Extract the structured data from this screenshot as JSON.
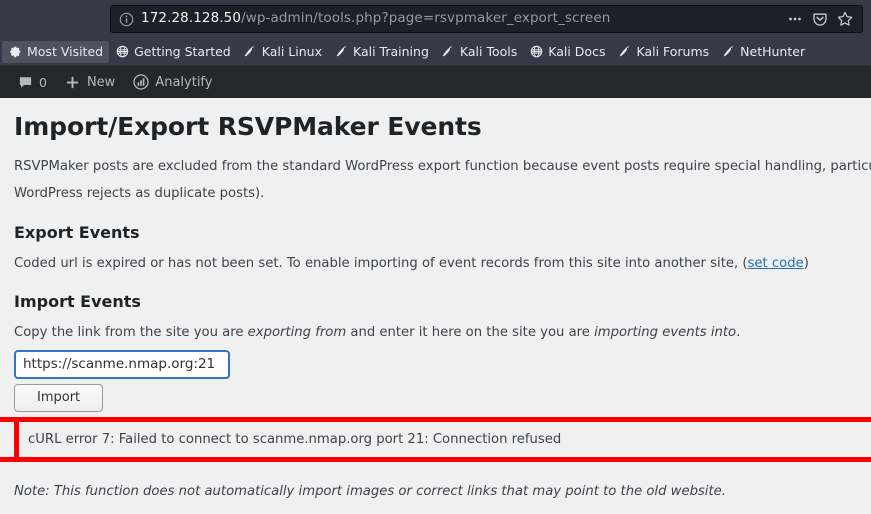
{
  "browser": {
    "url_host": "172.28.128.50",
    "url_path": "/wp-admin/tools.php?page=rsvpmaker_export_screen",
    "identity_icon": "info-icon",
    "page_actions_label": "…",
    "save_to_pocket_label": "save-to-pocket-icon",
    "bookmark_star_label": "bookmark-star-icon",
    "bookmarks": [
      {
        "label": "Most Visited",
        "icon": "gear-icon",
        "active": true
      },
      {
        "label": "Getting Started",
        "icon": "globe-icon",
        "active": false
      },
      {
        "label": "Kali Linux",
        "icon": "dragon-icon",
        "active": false
      },
      {
        "label": "Kali Training",
        "icon": "dragon-icon",
        "active": false
      },
      {
        "label": "Kali Tools",
        "icon": "dragon-icon",
        "active": false
      },
      {
        "label": "Kali Docs",
        "icon": "globe-icon",
        "active": false
      },
      {
        "label": "Kali Forums",
        "icon": "dragon-icon",
        "active": false
      },
      {
        "label": "NetHunter",
        "icon": "dragon-icon",
        "active": false
      }
    ]
  },
  "adminbar": {
    "comments_count": "0",
    "comments_icon": "comment-bubble-icon",
    "new_label": "New",
    "new_icon": "plus-icon",
    "analytify_label": "Analytify",
    "analytify_icon": "bar-chart-circle-icon"
  },
  "page": {
    "title": "Import/Export RSVPMaker Events",
    "intro_line1": "RSVPMaker posts are excluded from the standard WordPress export function because event posts require special handling, particularly those that hav",
    "intro_line2": "WordPress rejects as duplicate posts).",
    "export": {
      "heading": "Export Events",
      "text_before_link": "Coded url is expired or has not been set. To enable importing of event records from this site into another site, (",
      "link_label": "set code",
      "text_after_link": ")"
    },
    "import": {
      "heading": "Import Events",
      "instruction_part1": "Copy the link from the site you are ",
      "instruction_em1": "exporting from",
      "instruction_part2": " and enter it here on the site you are ",
      "instruction_em2": "importing events into",
      "instruction_part3": ".",
      "input_value": "https://scanme.nmap.org:21",
      "input_placeholder": "",
      "button_label": "Import",
      "error_message": "cURL error 7: Failed to connect to scanme.nmap.org port 21: Connection refused"
    },
    "note": "Note: This function does not automatically import images or correct links that may point to the old website."
  },
  "colors": {
    "chrome_bg": "#353a47",
    "urlbar_bg": "#1c2029",
    "adminbar_bg": "#23282d",
    "page_bg": "#f0f0f1",
    "link": "#2271b1",
    "input_focus_border": "#2d76c4",
    "error_border": "#fc0000"
  }
}
